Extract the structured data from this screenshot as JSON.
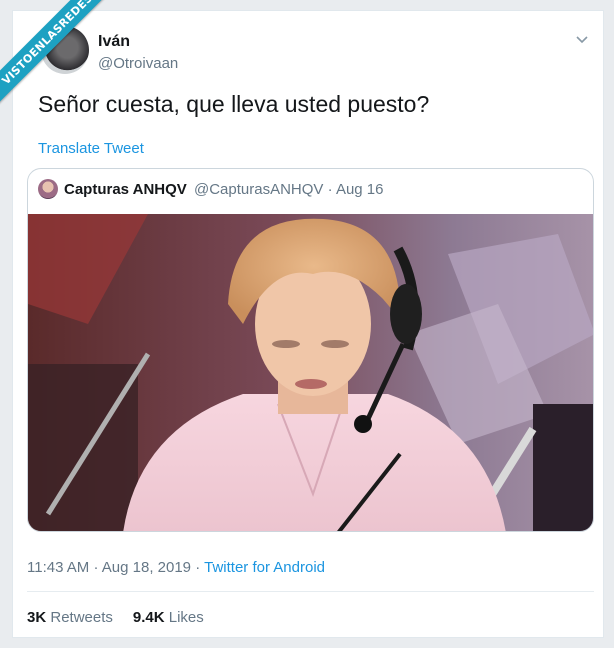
{
  "watermark": {
    "text": "VISTOENLASREDES"
  },
  "tweet": {
    "author_name": "Iván",
    "author_handle": "@Otroivaan",
    "text": "Señor cuesta, que lleva usted puesto?",
    "translate_label": "Translate Tweet",
    "time": "11:43 AM",
    "separator": "·",
    "date": "Aug 18, 2019",
    "source": "Twitter for Android"
  },
  "quoted": {
    "author_name": "Capturas ANHQV",
    "author_handle": "@CapturasANHQV",
    "date": "Aug 16"
  },
  "stats": {
    "retweets_count": "3K",
    "retweets_label": "Retweets",
    "likes_count": "9.4K",
    "likes_label": "Likes"
  },
  "colors": {
    "link": "#1b95e0",
    "muted": "#657786",
    "text": "#14171a",
    "ribbon": "#1da1c2"
  },
  "icons": {
    "caret": "chevron-down-icon"
  }
}
